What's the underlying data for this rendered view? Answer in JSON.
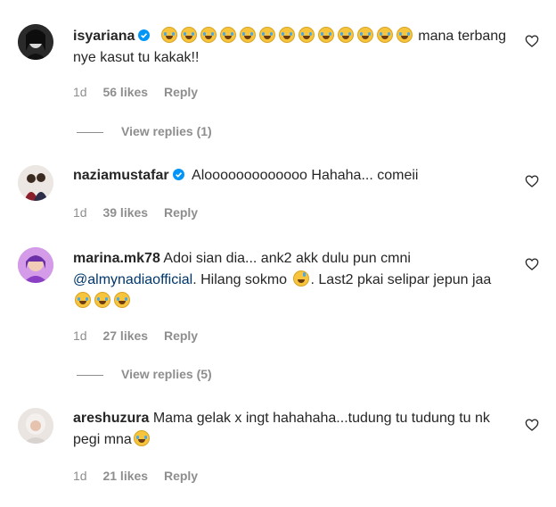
{
  "comments": [
    {
      "username": "isyariana",
      "verified": true,
      "text_after_emojis": " mana terbang nye kasut tu kakak!!",
      "emoji_count": 13,
      "time": "1d",
      "likes": "56 likes",
      "reply": "Reply",
      "view_replies": "View replies (1)"
    },
    {
      "username": "naziamustafar",
      "verified": true,
      "text": "Alooooooooooooo Hahaha... comeii",
      "time": "1d",
      "likes": "39 likes",
      "reply": "Reply"
    },
    {
      "username": "marina.mk78",
      "verified": false,
      "text_part1": "Adoi sian dia... ank2 akk dulu pun cmni",
      "mention": "@almynadiaofficial",
      "text_part2": ". Hilang sokmo",
      "text_part3": ". Last2 pkai selipar jepun jaa",
      "time": "1d",
      "likes": "27 likes",
      "reply": "Reply",
      "view_replies": "View replies (5)"
    },
    {
      "username": "areshuzura",
      "verified": false,
      "text": "Mama gelak x ingt hahahaha...tudung tu tudung tu nk pegi mna",
      "time": "1d",
      "likes": "21 likes",
      "reply": "Reply"
    }
  ],
  "icons": {
    "like": "heart-icon",
    "verified": "verified-badge-icon",
    "emoji": "face-with-tears-of-joy"
  },
  "colors": {
    "verified": "#0095f6",
    "mention": "#00376b",
    "meta": "#8e8e8e"
  }
}
